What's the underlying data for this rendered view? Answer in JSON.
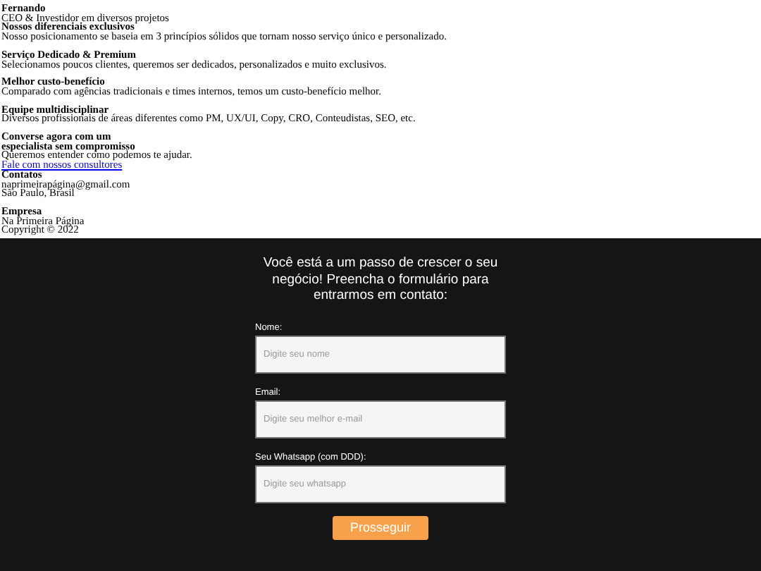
{
  "info_blocks": [
    {
      "items": [
        {
          "kind": "heading",
          "text": "Fernando"
        },
        {
          "kind": "text",
          "text": "CEO & Investidor em diversos projetos"
        },
        {
          "kind": "heading",
          "text": "Nossos diferenciais exclusivos"
        },
        {
          "kind": "text",
          "text": "Nosso posicionamento se baseia em 3 princípios sólidos que tornam nosso serviço único e personalizado."
        }
      ]
    },
    {
      "items": [
        {
          "kind": "heading",
          "text": "Serviço Dedicado & Premium"
        },
        {
          "kind": "text",
          "text": "Selecionamos poucos clientes, queremos ser dedicados, personalizados e muito exclusivos."
        }
      ]
    },
    {
      "items": [
        {
          "kind": "heading",
          "text": "Melhor custo-benefício"
        },
        {
          "kind": "text",
          "text": "Comparado com agências tradicionais e times internos, temos um custo-benefício melhor."
        }
      ]
    },
    {
      "items": [
        {
          "kind": "heading",
          "text": "Equipe multidisciplinar"
        },
        {
          "kind": "text",
          "text": "Diversos profissionais de áreas diferentes como PM, UX/UI, Copy, CRO, Conteudistas, SEO, etc."
        }
      ]
    },
    {
      "items": [
        {
          "kind": "heading",
          "text": "Converse agora com um"
        },
        {
          "kind": "heading",
          "text": "especialista sem compromisso"
        },
        {
          "kind": "text",
          "text": "Queremos entender como podemos te ajudar."
        },
        {
          "kind": "link",
          "text": "Fale com nossos consultores"
        },
        {
          "kind": "heading",
          "text": "Contatos"
        },
        {
          "kind": "text",
          "text": "naprimeirapágina@gmail.com"
        },
        {
          "kind": "text",
          "text": "São Paulo, Brasil"
        }
      ]
    },
    {
      "items": [
        {
          "kind": "heading",
          "text": "Empresa"
        },
        {
          "kind": "text",
          "text": "Na Primeira Página"
        },
        {
          "kind": "text",
          "text": "Copyright © 2022"
        }
      ]
    }
  ],
  "form": {
    "title": "Você está a um passo de crescer o seu negócio! Preencha o formulário para entrarmos em contato:",
    "fields": [
      {
        "label": "Nome:",
        "placeholder": "Digite seu nome"
      },
      {
        "label": "Email:",
        "placeholder": "Digite seu melhor e-mail"
      },
      {
        "label": "Seu Whatsapp (com DDD):",
        "placeholder": "Digite seu whatsapp"
      }
    ],
    "submit": "Prosseguir"
  }
}
